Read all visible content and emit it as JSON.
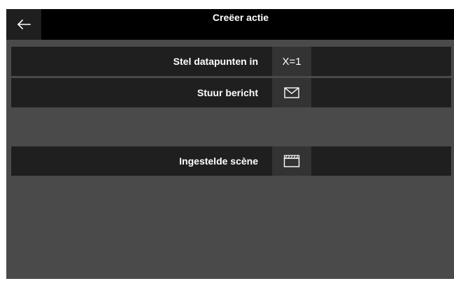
{
  "header": {
    "title": "Creëer actie",
    "back_icon": "arrow-left-icon"
  },
  "actions": [
    {
      "label": "Stel datapunten in",
      "button_text": "X=1",
      "icon": "x-equals-1-icon"
    },
    {
      "label": "Stuur bericht",
      "icon": "envelope-icon"
    },
    {
      "label": "Ingestelde scène",
      "icon": "clapperboard-icon"
    }
  ],
  "colors": {
    "background": "#4a4a4a",
    "header": "#000000",
    "row": "#1f1f1f",
    "button": "#333333",
    "text": "#ffffff"
  }
}
